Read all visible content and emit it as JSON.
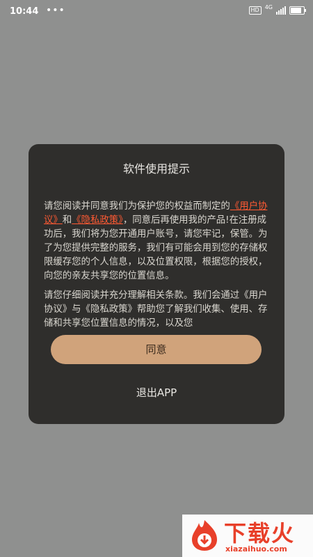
{
  "status_bar": {
    "time": "10:44",
    "dots": "•••",
    "hd": "HD",
    "network": "4G",
    "battery_level": 0.85
  },
  "dialog": {
    "title": "软件使用提示",
    "para1_part1": "请您阅读并同意我们为保护您的权益而制定的",
    "user_agreement_link": "《用户协议》",
    "and_text": "和",
    "privacy_policy_link": "《隐私政策》",
    "para1_part2": "，同意后再使用我的产品!在注册成功后，我们将为您开通用户账号，请您牢记，保管。为了为您提供完整的服务，我们有可能会用到您的存储权限缓存您的个人信息，以及位置权限，根据您的授权，向您的亲友共享您的位置信息。",
    "para2": "请您仔细阅读并充分理解相关条款。我们会通过《用户协议》与《隐私政策》帮助您了解我们收集、使用、存储和共享您位置信息的情况，以及您",
    "agree_button": "同意",
    "exit_button": "退出APP"
  },
  "watermark": {
    "title": "下载火",
    "subtitle": "xiazaihuo.com"
  }
}
